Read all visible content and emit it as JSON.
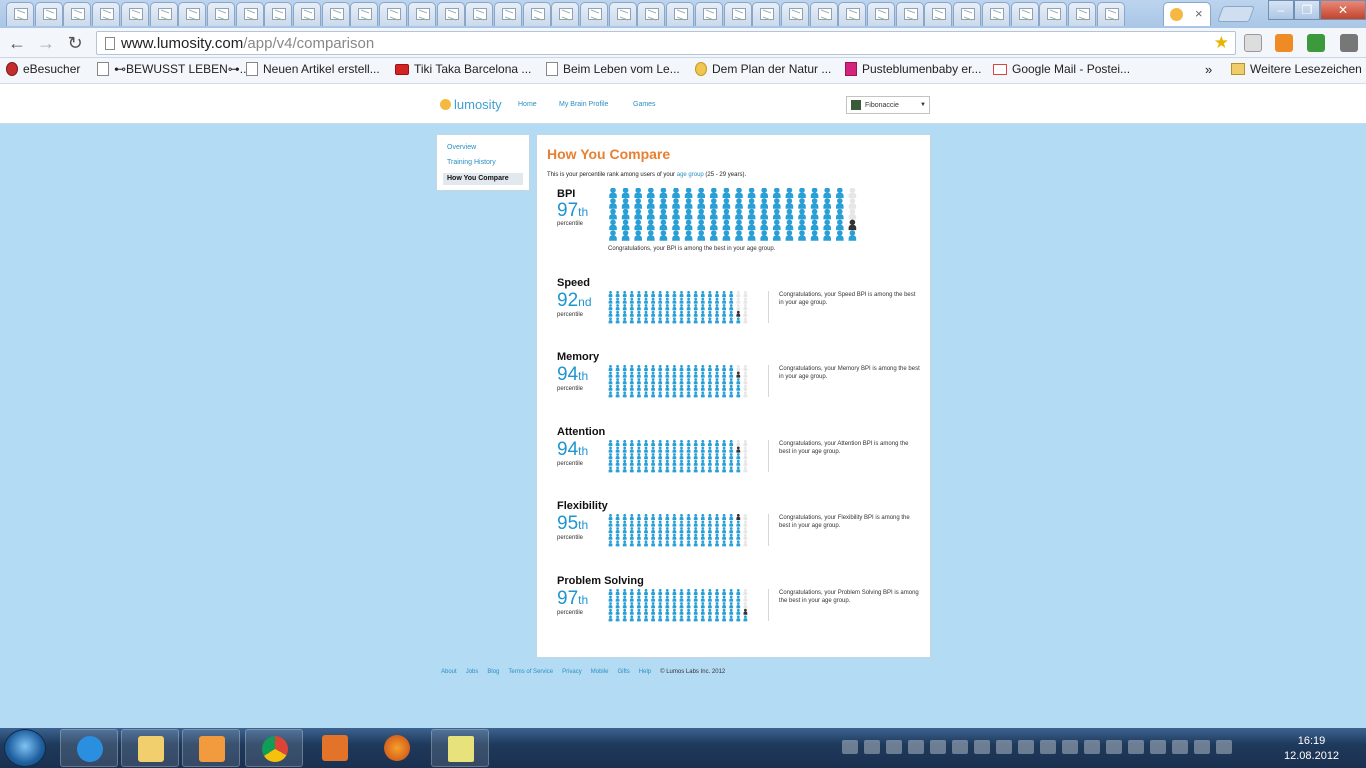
{
  "browser": {
    "address": {
      "domain": "www.lumosity.com",
      "path": "/app/v4/comparison"
    },
    "tab_close": "×",
    "window_controls": {
      "minimize": "–",
      "maximize": "❐",
      "close": "✕"
    },
    "bookmarks": [
      {
        "label": "eBesucher",
        "icon": "flower-icon"
      },
      {
        "label": "⊷BEWUSST LEBEN⊶...",
        "icon": "page-icon"
      },
      {
        "label": "Neuen Artikel erstell...",
        "icon": "page-icon"
      },
      {
        "label": "Tiki Taka Barcelona ...",
        "icon": "youtube-icon"
      },
      {
        "label": "Beim Leben vom Le...",
        "icon": "page-icon"
      },
      {
        "label": "Dem Plan der Natur ...",
        "icon": "moon-icon"
      },
      {
        "label": "Pusteblumenbaby er...",
        "icon": "butterfly-icon"
      },
      {
        "label": "Google Mail - Postei...",
        "icon": "gmail-icon"
      }
    ],
    "bookmarks_overflow": "»",
    "other_bookmarks": "Weitere Lesezeichen"
  },
  "site": {
    "logo": "lumosity",
    "nav": [
      "Home",
      "My Brain Profile",
      "Games"
    ],
    "user": "Fibonaccie"
  },
  "sidebar": {
    "items": [
      "Overview",
      "Training History",
      "How You Compare"
    ]
  },
  "main": {
    "title": "How You Compare",
    "intro_pre": "This is your percentile rank among users of your ",
    "intro_link": "age group",
    "intro_post": " (25 - 29 years).",
    "percentile_label": "percentile",
    "bpi": {
      "title": "BPI",
      "number": "97",
      "suffix": "th",
      "value": 97,
      "message": "Congratulations, your BPI is among the best in your age group."
    },
    "areas": [
      {
        "title": "Speed",
        "number": "92",
        "suffix": "nd",
        "value": 92,
        "message": "Congratulations, your Speed BPI is among the best in your age group."
      },
      {
        "title": "Memory",
        "number": "94",
        "suffix": "th",
        "value": 94,
        "message": "Congratulations, your Memory BPI is among the best in your age group."
      },
      {
        "title": "Attention",
        "number": "94",
        "suffix": "th",
        "value": 94,
        "message": "Congratulations, your Attention BPI is among the best in your age group."
      },
      {
        "title": "Flexibility",
        "number": "95",
        "suffix": "th",
        "value": 95,
        "message": "Congratulations, your Flexibility BPI is among the best in your age group."
      },
      {
        "title": "Problem Solving",
        "number": "97",
        "suffix": "th",
        "value": 97,
        "message": "Congratulations, your Problem Solving BPI is among the best in your age group."
      }
    ]
  },
  "footer": {
    "links": [
      "About",
      "Jobs",
      "Blog",
      "Terms of Service",
      "Privacy",
      "Mobile",
      "Gifts",
      "Help"
    ],
    "copyright": "© Lumos Labs Inc. 2012"
  },
  "taskbar": {
    "time": "16:19",
    "date": "12.08.2012"
  },
  "colors": {
    "accent_blue": "#1f95d0",
    "person_blue": "#2a9fd6",
    "person_you": "#333333",
    "person_empty": "#e6e6e6",
    "title_orange": "#e87f31",
    "page_bg": "#b4dbf4"
  }
}
